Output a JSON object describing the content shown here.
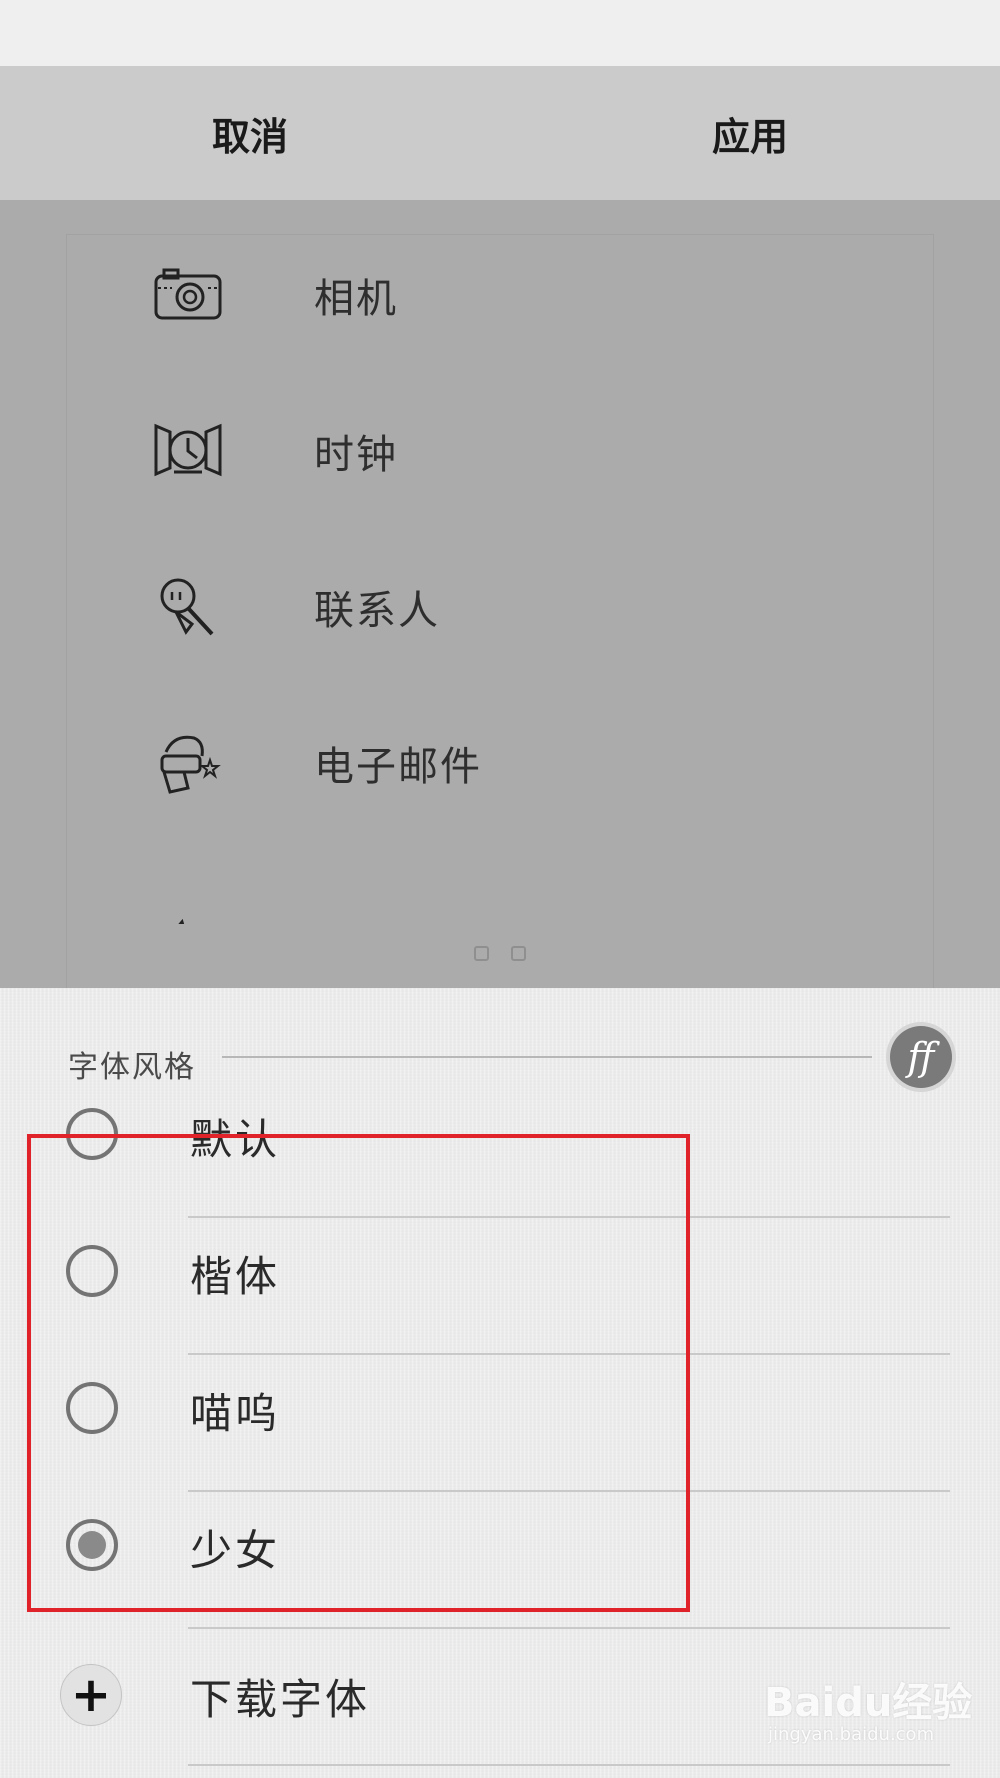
{
  "action_bar": {
    "cancel_label": "取消",
    "apply_label": "应用"
  },
  "preview": {
    "items": [
      {
        "label": "相机",
        "icon": "camera-icon"
      },
      {
        "label": "时钟",
        "icon": "clock-icon"
      },
      {
        "label": "联系人",
        "icon": "contacts-icon"
      },
      {
        "label": "电子邮件",
        "icon": "email-icon"
      }
    ],
    "page_count": 2
  },
  "font_style": {
    "header": "字体风格",
    "badge_text": "ff",
    "options": [
      {
        "label": "默认",
        "selected": false
      },
      {
        "label": "楷体",
        "selected": false
      },
      {
        "label": "喵呜",
        "selected": false
      },
      {
        "label": "少女",
        "selected": true
      }
    ],
    "download_label": "下载字体",
    "download_icon": "+"
  },
  "watermark": {
    "main": "Baidu经验",
    "sub": "jingyan.baidu.com"
  },
  "colors": {
    "highlight": "#e0222b",
    "preview_bg": "#ababab",
    "action_bar_bg": "#cbcbcb"
  }
}
